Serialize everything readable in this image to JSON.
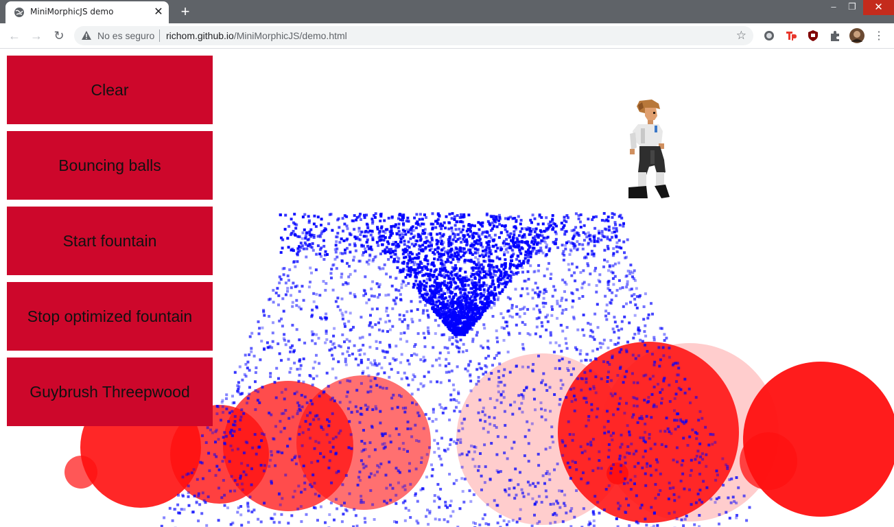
{
  "tab": {
    "title": "MiniMorphicJS demo",
    "close_glyph": "✕"
  },
  "new_tab_glyph": "+",
  "window": {
    "minimize_glyph": "–",
    "restore_glyph": "❐",
    "close_glyph": "✕"
  },
  "address_bar": {
    "security_label": "No es seguro",
    "url_host": "richom.github.io",
    "url_path": "/MiniMorphicJS/demo.html"
  },
  "nav": {
    "back_glyph": "←",
    "forward_glyph": "→",
    "reload_glyph": "↻",
    "bookmark_glyph": "☆",
    "menu_glyph": "⋮"
  },
  "buttons": [
    {
      "label": "Clear"
    },
    {
      "label": "Bouncing balls"
    },
    {
      "label": "Start fountain"
    },
    {
      "label": "Stop optimized fountain"
    },
    {
      "label": "Guybrush Threepwood"
    }
  ],
  "colors": {
    "button_bg": "#cd072b",
    "ball_red": "#ff1010",
    "ball_pink": "#ffc4c4",
    "particle": "#0000ff"
  },
  "icons": [
    "globe-icon",
    "close-icon",
    "plus-icon",
    "back-icon",
    "forward-icon",
    "reload-icon",
    "warning-icon",
    "star-icon",
    "extension-icon",
    "avatar",
    "menu-icon"
  ]
}
